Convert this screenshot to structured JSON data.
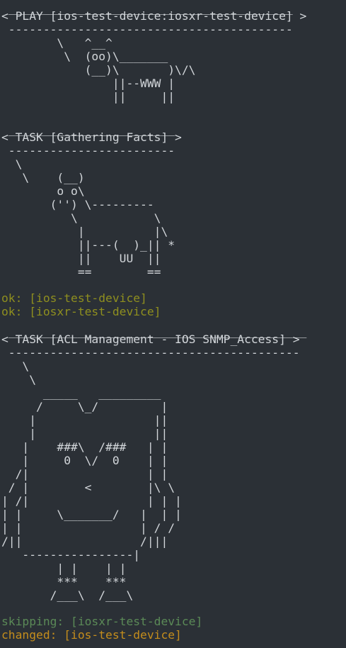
{
  "terminal": {
    "colors": {
      "background": "#2b3036",
      "text": "#d2d6da",
      "ok": "#8f8f1f",
      "skipping": "#5b8a57",
      "changed": "#c48d1c"
    },
    "play_banner": [
      " _________________________________________ ",
      "< PLAY [ios-test-device:iosxr-test-device] >",
      " ----------------------------------------- ",
      "        \\   ^__^",
      "         \\  (oo)\\_______",
      "            (__)\\       )\\/\\",
      "                ||--WWW |",
      "                ||     ||"
    ],
    "gathering_banner": [
      " ________________________ ",
      "< TASK [Gathering Facts] >",
      " ------------------------ ",
      "  \\",
      "   \\    (__)",
      "        o o\\",
      "       ('') \\---------",
      "          \\           \\",
      "           |          |\\",
      "           ||---(  )_|| *",
      "           ||    UU  ||",
      "           ==        =="
    ],
    "gathering_results": [
      {
        "text": "ok: [ios-test-device]",
        "status": "ok"
      },
      {
        "text": "ok: [iosxr-test-device]",
        "status": "ok"
      }
    ],
    "acl_banner": [
      " ___________________________________________ ",
      "< TASK [ACL Management - IOS SNMP_Access] >",
      " ------------------------------------------ ",
      "   \\",
      "    \\",
      "      _____   _________",
      "     /     \\_/         |",
      "    |                 ||",
      "    |                 ||",
      "   |    ###\\  /###   | |",
      "   |     0  \\/  0    | |",
      "  /|                 | |",
      " / |        <        |\\ \\",
      "| /|                 | | |",
      "| |     \\_______/   |  | |",
      "| |                 | / /",
      "/||                 /|||",
      "   ----------------|",
      "        | |    | |",
      "        ***    ***",
      "       /___\\  /___\\"
    ],
    "acl_results": [
      {
        "text": "skipping: [iosxr-test-device]",
        "status": "skipping"
      },
      {
        "text": "changed: [ios-test-device]",
        "status": "changed"
      }
    ]
  }
}
